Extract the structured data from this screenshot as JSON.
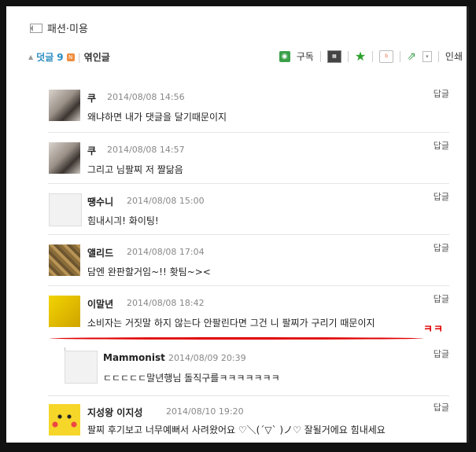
{
  "category": "패션·미용",
  "toolbar": {
    "comments_label": "덧글",
    "comments_count": "9",
    "badge": "N",
    "related_label": "엮인글",
    "subscribe": "구독",
    "print": "인쇄"
  },
  "reply_label": "답글",
  "comments": [
    {
      "name": "쿠",
      "date": "2014/08/08 14:56",
      "text": "왜냐하면 내가 댓글을 달기때문이지"
    },
    {
      "name": "쿠",
      "date": "2014/08/08 14:57",
      "text": "그리고 님팔찌 저 짤닮음"
    },
    {
      "name": "땡수니",
      "date": "2014/08/08 15:00",
      "text": "힘내시긔! 화이팅!"
    },
    {
      "name": "앨리드",
      "date": "2014/08/08 17:04",
      "text": "담엔 완판할거임~!! 홧팀~><"
    },
    {
      "name": "이말년",
      "date": "2014/08/08 18:42",
      "text": "소비자는 거짓말 하지 않는다 안팔린다면 그건 니 팔찌가 구리기 때문이지"
    },
    {
      "name": "Mammonist",
      "date": "2014/08/09 20:39",
      "text": "ㄷㄷㄷㄷㄷ말년행님 돌직구를ㅋㅋㅋㅋㅋㅋㅋ"
    },
    {
      "name": "지성왕 이지성",
      "date": "2014/08/10 19:20",
      "text": "팔찌 후기보고 너무예뻐서 사려왔어요 ♡＼(ˊ▽ˋ )ノ♡ 잘될거에요 힘내세요",
      "text2": "ㅋㅋ"
    }
  ],
  "annotation": "ㅋㅋ",
  "colors": {
    "accent": "#2a8ec0",
    "annotation": "#e10000"
  }
}
